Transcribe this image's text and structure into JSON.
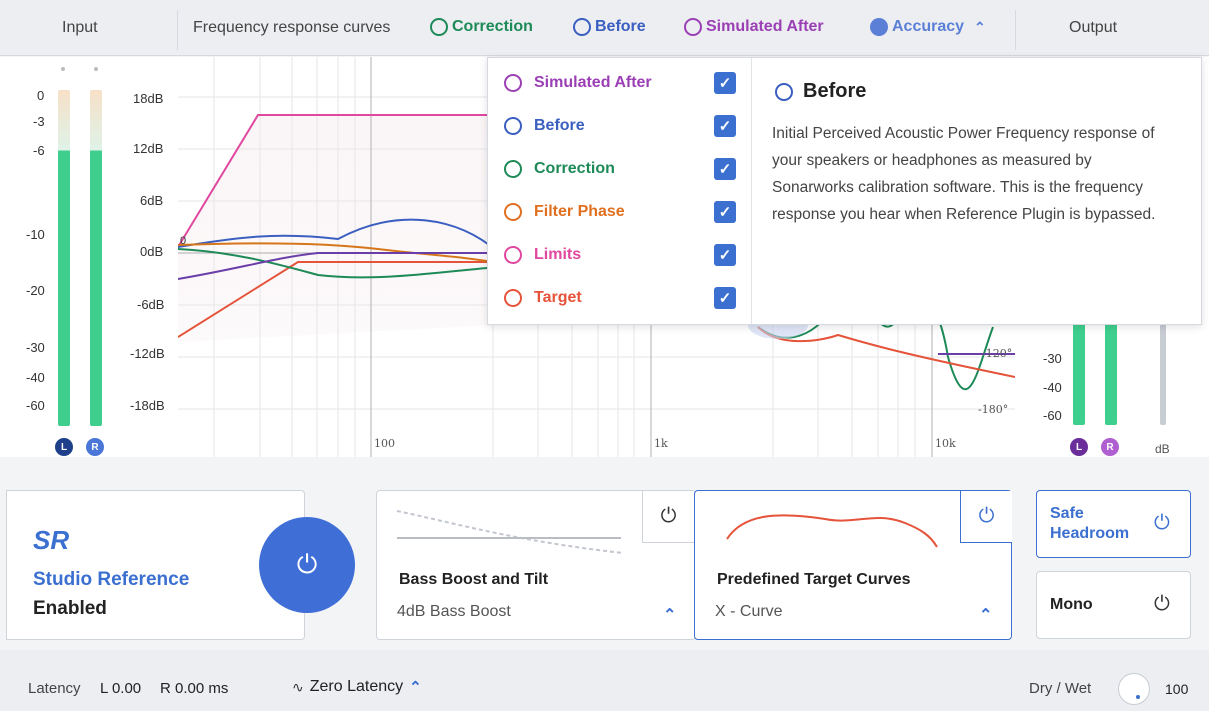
{
  "header": {
    "input_label": "Input",
    "output_label": "Output",
    "freq_label": "Frequency response curves",
    "legend": [
      {
        "label": "Correction",
        "color": "#1e8a57",
        "style": "ring"
      },
      {
        "label": "Before",
        "color": "#3b5fc0",
        "style": "ring"
      },
      {
        "label": "Simulated After",
        "color": "#9b3fb5",
        "style": "ring"
      },
      {
        "label": "Accuracy",
        "color": "#5b7fd6",
        "style": "filled"
      }
    ],
    "accuracy_chevron": "^"
  },
  "input_meter": {
    "scale": [
      "0",
      "-3",
      "-6",
      "-10",
      "-20",
      "-30",
      "-40",
      "-60"
    ],
    "channels": [
      "L",
      "R"
    ],
    "color": "#3ecf8e"
  },
  "graph": {
    "db_labels": [
      "18dB",
      "12dB",
      "6dB",
      "0dB",
      "-6dB",
      "-12dB",
      "-18dB"
    ],
    "freq_labels": [
      "100",
      "1k",
      "10k"
    ],
    "phase_labels": [
      "-120°",
      "-180°"
    ],
    "zero_marker": "0"
  },
  "output_meter": {
    "scale": [
      "-30",
      "-40",
      "-60"
    ],
    "channels": [
      "L",
      "R"
    ],
    "unit": "dB"
  },
  "popover": {
    "items": [
      {
        "label": "Simulated After",
        "color": "#9b3fb5",
        "checked": true
      },
      {
        "label": "Before",
        "color": "#3b5fc0",
        "checked": true
      },
      {
        "label": "Correction",
        "color": "#1e8a57",
        "checked": true
      },
      {
        "label": "Filter Phase",
        "color": "#e07020",
        "checked": true
      },
      {
        "label": "Limits",
        "color": "#e0479e",
        "checked": true
      },
      {
        "label": "Target",
        "color": "#e5533a",
        "checked": true
      }
    ],
    "info_title": "Before",
    "info_body": "Initial Perceived Acoustic Power Frequency response of your speakers or headphones as measured by Sonarworks calibration software. This is the frequency response you hear when Reference Plugin is bypassed."
  },
  "studio": {
    "logo": "SR",
    "name": "Studio Reference",
    "status": "Enabled"
  },
  "bass_module": {
    "title": "Bass Boost and Tilt",
    "value": "4dB Bass Boost"
  },
  "target_module": {
    "title": "Predefined Target Curves",
    "value": "X - Curve"
  },
  "safe_headroom": {
    "label_line1": "Safe",
    "label_line2": "Headroom"
  },
  "mono": {
    "label": "Mono"
  },
  "footer": {
    "latency_label": "Latency",
    "latency_l": "L 0.00",
    "latency_r": "R 0.00 ms",
    "zero_latency": "Zero Latency",
    "drywet_label": "Dry / Wet",
    "drywet_value": "100"
  },
  "colors": {
    "accent": "#3b6fd0",
    "meter_green": "#3ecf8e"
  }
}
